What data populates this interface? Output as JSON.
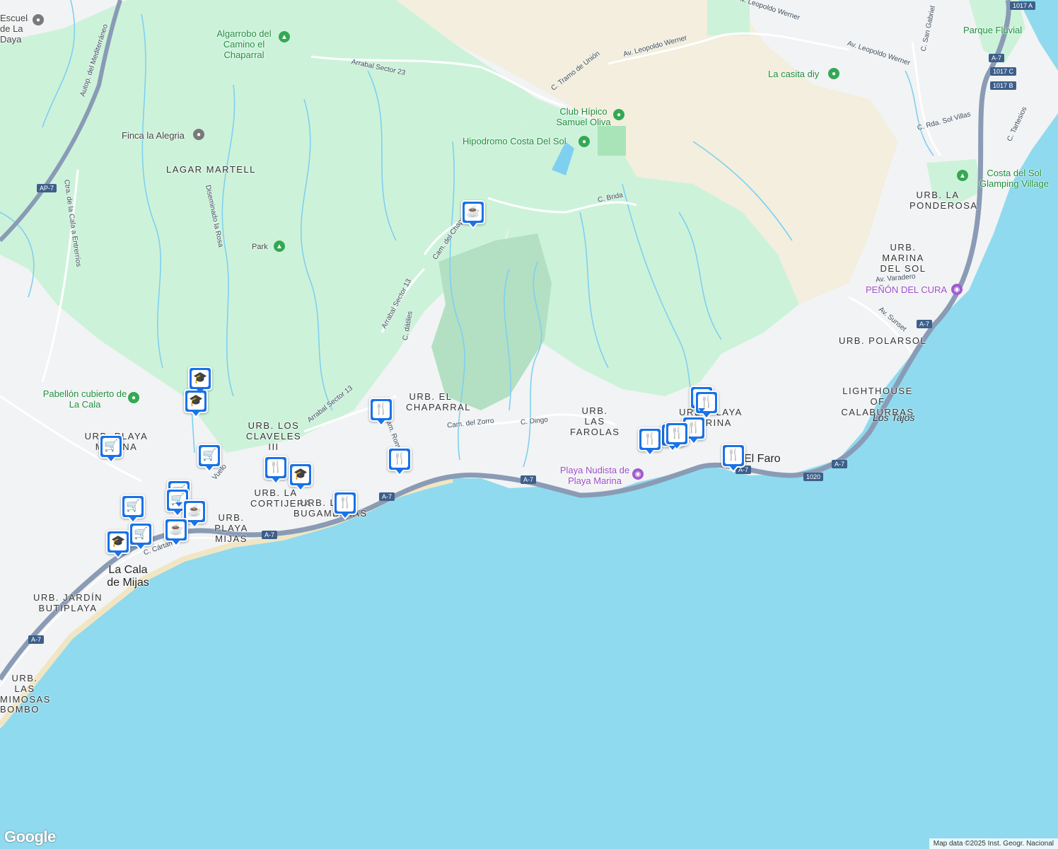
{
  "map": {
    "areas": [
      {
        "id": "lagar-martell",
        "text": "LAGAR MARTELL"
      },
      {
        "id": "urb-el-chaparral",
        "text": "URB. EL CHAPARRAL"
      },
      {
        "id": "urb-los-claveles",
        "text": "URB. LOS CLAVELES III"
      },
      {
        "id": "urb-la-cortijera",
        "text": "URB. LA CORTIJERA"
      },
      {
        "id": "urb-playa-mijas",
        "text": "URB. PLAYA MIJAS"
      },
      {
        "id": "urb-bugambilias",
        "text": "URB. LAS BUGAMBILIAS"
      },
      {
        "id": "urb-las-farolas",
        "text": "URB. LAS FAROLAS"
      },
      {
        "id": "urb-playa-marina",
        "text": "URB. PLAYA MARINA"
      },
      {
        "id": "urb-la-ponderosa",
        "text": "URB. LA PONDEROSA"
      },
      {
        "id": "urb-marina-del-sol",
        "text": "URB. MARINA DEL SOL"
      },
      {
        "id": "urb-polarsol",
        "text": "URB. POLARSOL"
      },
      {
        "id": "urb-playa-marina-west",
        "text": "URB. PLAYA MARINA"
      },
      {
        "id": "urb-jardin-butiplaya",
        "text": "URB. JARDÍN BUTIPLAYA"
      },
      {
        "id": "urb-las-mimosas",
        "text": "URB. LAS MIMOSAS"
      },
      {
        "id": "bombo",
        "text": "BOMBO"
      }
    ],
    "roads": [
      {
        "id": "autop-mediterraneo",
        "text": "Autop. del Mediterráneo"
      },
      {
        "id": "arrabal-23",
        "text": "Arrabal Sector 23"
      },
      {
        "id": "arrabal-13a",
        "text": "Arrabal Sector 13"
      },
      {
        "id": "arrabal-13b",
        "text": "Arrabal Sector 13"
      },
      {
        "id": "ctra-cala",
        "text": "Ctra. de la Cala a Entrerríos"
      },
      {
        "id": "diseminado-rosa",
        "text": "Diseminado la Rosa"
      },
      {
        "id": "cam-chaparral",
        "text": "Cam. del Chaparral"
      },
      {
        "id": "c-datiles",
        "text": "C. dátiles"
      },
      {
        "id": "c-tramo-union",
        "text": "C. Tramo de Unión"
      },
      {
        "id": "av-leopoldo-1",
        "text": "Av. Leopoldo Werner"
      },
      {
        "id": "av-leopoldo-2",
        "text": "Av. Leopoldo Werner"
      },
      {
        "id": "av-leopoldo-3",
        "text": "Av. Leopoldo Werner"
      },
      {
        "id": "c-brida",
        "text": "C. Brida"
      },
      {
        "id": "cam-zorro",
        "text": "Cam. del Zorro"
      },
      {
        "id": "c-dingo",
        "text": "C. Dingo"
      },
      {
        "id": "c-san-gabriel",
        "text": "C. San Gabriel"
      },
      {
        "id": "c-rda-sol-villas",
        "text": "C. Rda. Sol Villas"
      },
      {
        "id": "c-tartesios",
        "text": "C. Tartesios"
      },
      {
        "id": "av-varadero",
        "text": "Av. Varadero"
      },
      {
        "id": "av-sunset",
        "text": "Av. Sunset"
      },
      {
        "id": "c-cartama",
        "text": "C. Cártama"
      },
      {
        "id": "cam-romero",
        "text": "Cam. Romero"
      },
      {
        "id": "vuelo",
        "text": "Vuelo"
      }
    ],
    "pois": [
      {
        "id": "algarrobo",
        "text": "Algarrobo del Camino el Chaparral",
        "kind": "green",
        "icon": "tree-icon"
      },
      {
        "id": "finca-alegria",
        "text": "Finca la Alegria",
        "kind": "gray",
        "icon": "pin-icon"
      },
      {
        "id": "park",
        "text": "Park",
        "kind": "green",
        "icon": "tree-icon"
      },
      {
        "id": "pabellon",
        "text": "Pabellón cubierto de La Cala",
        "kind": "green",
        "icon": "pin-icon"
      },
      {
        "id": "club-hipico",
        "text": "Club Hípico Samuel Oliva",
        "kind": "green",
        "icon": "pin-icon"
      },
      {
        "id": "hipodromo",
        "text": "Hipodromo Costa Del Sol",
        "kind": "green",
        "icon": "pin-icon"
      },
      {
        "id": "casita-diy",
        "text": "La casita diy",
        "kind": "green",
        "icon": "pin-icon"
      },
      {
        "id": "parque-fluvial",
        "text": "Parque Fluvial",
        "kind": "green",
        "icon": "tree-icon"
      },
      {
        "id": "glamping",
        "text": "Costa del Sol Glamping Village",
        "kind": "green",
        "icon": "camping-icon"
      },
      {
        "id": "penon-cura",
        "text": "PEÑÓN DEL CURA",
        "kind": "purple",
        "icon": "camera-icon"
      },
      {
        "id": "playa-nudista",
        "text": "Playa Nudista de Playa Marina",
        "kind": "purple",
        "icon": "camera-icon"
      },
      {
        "id": "escuela-daya",
        "text": "Escuela de La Daya",
        "kind": "gray",
        "icon": "pin-icon"
      },
      {
        "id": "lighthouse",
        "text": "LIGHTHOUSE OF CALABURRAS",
        "kind": "area",
        "icon": ""
      },
      {
        "id": "los-tajos",
        "text": "Los Tajos",
        "kind": "italic",
        "icon": ""
      },
      {
        "id": "el-faro",
        "text": "El Faro",
        "kind": "town",
        "icon": ""
      },
      {
        "id": "la-cala",
        "text": "La Cala de Mijas",
        "kind": "town",
        "icon": ""
      }
    ],
    "shields": [
      {
        "id": "ap7",
        "text": "AP-7"
      },
      {
        "id": "a7-1",
        "text": "A-7"
      },
      {
        "id": "a7-2",
        "text": "A-7"
      },
      {
        "id": "a7-3",
        "text": "A-7"
      },
      {
        "id": "a7-4",
        "text": "A-7"
      },
      {
        "id": "a7-5",
        "text": "A-7"
      },
      {
        "id": "a7-6",
        "text": "A-7"
      },
      {
        "id": "a7-7",
        "text": "A-7"
      },
      {
        "id": "a7-8",
        "text": "A-7"
      },
      {
        "id": "r1017a",
        "text": "1017 A"
      },
      {
        "id": "r1017c",
        "text": "1017 C"
      },
      {
        "id": "r1017b",
        "text": "1017 B"
      },
      {
        "id": "r1020",
        "text": "1020"
      }
    ],
    "markers": [
      {
        "id": "m-coffee-1",
        "icon": "coffee-icon",
        "glyph": "☕"
      },
      {
        "id": "m-school-1",
        "icon": "school-icon",
        "glyph": "🎓"
      },
      {
        "id": "m-school-2",
        "icon": "school-icon",
        "glyph": "🎓"
      },
      {
        "id": "m-cart-1",
        "icon": "cart-icon",
        "glyph": "🛒"
      },
      {
        "id": "m-cart-2",
        "icon": "cart-icon",
        "glyph": "🛒"
      },
      {
        "id": "m-rest-1",
        "icon": "restaurant-icon",
        "glyph": "🍴"
      },
      {
        "id": "m-rest-2",
        "icon": "restaurant-icon",
        "glyph": "🍴"
      },
      {
        "id": "m-rest-3",
        "icon": "restaurant-icon",
        "glyph": "🍴"
      },
      {
        "id": "m-school-3",
        "icon": "school-icon",
        "glyph": "🎓"
      },
      {
        "id": "m-rest-4",
        "icon": "restaurant-icon",
        "glyph": "🍴"
      },
      {
        "id": "m-cart-3",
        "icon": "cart-icon",
        "glyph": "🛒"
      },
      {
        "id": "m-cart-4",
        "icon": "cart-icon",
        "glyph": "🛒"
      },
      {
        "id": "m-cart-5",
        "icon": "cart-icon",
        "glyph": "🛒"
      },
      {
        "id": "m-coffee-2",
        "icon": "coffee-icon",
        "glyph": "☕"
      },
      {
        "id": "m-coffee-3",
        "icon": "coffee-icon",
        "glyph": "☕"
      },
      {
        "id": "m-cart-6",
        "icon": "cart-icon",
        "glyph": "🛒"
      },
      {
        "id": "m-school-4",
        "icon": "school-icon",
        "glyph": "🎓"
      },
      {
        "id": "m-rest-5",
        "icon": "restaurant-icon",
        "glyph": "🍴"
      },
      {
        "id": "m-rest-6",
        "icon": "restaurant-icon",
        "glyph": "🍴"
      },
      {
        "id": "m-rest-7",
        "icon": "restaurant-icon",
        "glyph": "🍴"
      },
      {
        "id": "m-rest-8",
        "icon": "restaurant-icon",
        "glyph": "🍴"
      },
      {
        "id": "m-rest-9",
        "icon": "restaurant-icon",
        "glyph": "🍴"
      },
      {
        "id": "m-rest-10",
        "icon": "restaurant-icon",
        "glyph": "🍴"
      },
      {
        "id": "m-rest-11",
        "icon": "restaurant-icon",
        "glyph": "🍴"
      }
    ],
    "colors": {
      "sea": "#8fdaee",
      "park": "#ccf2d9",
      "urban": "#f2f3f4",
      "sand": "#f5f0e1",
      "highway": "#8a9bb5",
      "river": "#7fd0f0",
      "marker": "#1a73e8"
    }
  },
  "footer": {
    "logo": "Google",
    "attribution": "Map data ©2025 Inst. Geogr. Nacional"
  }
}
